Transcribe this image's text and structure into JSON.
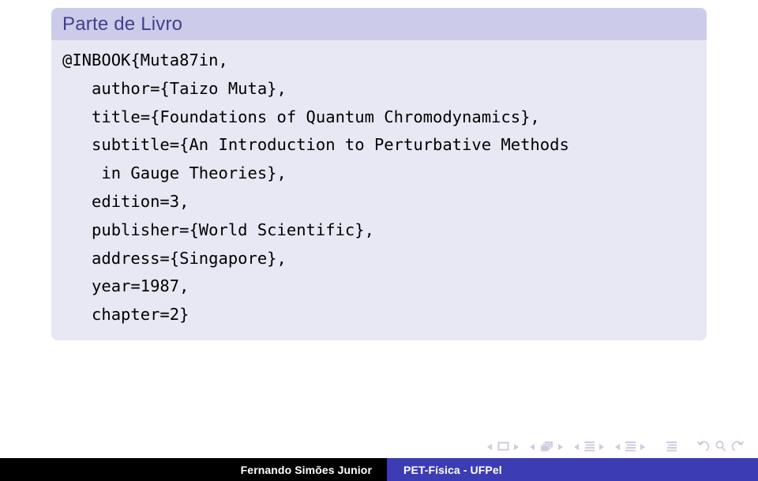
{
  "block": {
    "title": "Parte de Livro",
    "code_lines": [
      "@INBOOK{Muta87in,",
      "   author={Taizo Muta},",
      "   title={Foundations of Quantum Chromodynamics},",
      "   subtitle={An Introduction to Perturbative Methods",
      "    in Gauge Theories},",
      "   edition=3,",
      "   publisher={World Scientific},",
      "   address={Singapore},",
      "   year=1987,",
      "   chapter=2}"
    ],
    "code_text": "@INBOOK{Muta87in,\n   author={Taizo Muta},\n   title={Foundations of Quantum Chromodynamics},\n   subtitle={An Introduction to Perturbative Methods\n    in Gauge Theories},\n   edition=3,\n   publisher={World Scientific},\n   address={Singapore},\n   year=1987,\n   chapter=2}"
  },
  "navigation": {
    "items": [
      {
        "name": "slide-backward",
        "icon": "triangle-left"
      },
      {
        "name": "slide-indicator",
        "icon": "slide"
      },
      {
        "name": "slide-forward",
        "icon": "triangle-right"
      },
      {
        "name": "frame-backward",
        "icon": "triangle-left"
      },
      {
        "name": "frame-indicator",
        "icon": "frames"
      },
      {
        "name": "frame-forward",
        "icon": "triangle-right"
      },
      {
        "name": "subsection-backward",
        "icon": "triangle-left"
      },
      {
        "name": "subsection-indicator",
        "icon": "subsection"
      },
      {
        "name": "subsection-forward",
        "icon": "triangle-right"
      },
      {
        "name": "section-backward",
        "icon": "triangle-left"
      },
      {
        "name": "section-indicator",
        "icon": "section"
      },
      {
        "name": "section-forward",
        "icon": "triangle-right"
      },
      {
        "name": "presentation-indicator",
        "icon": "presentation"
      },
      {
        "name": "back-arrow",
        "icon": "arrow-back"
      },
      {
        "name": "search",
        "icon": "magnifier"
      },
      {
        "name": "forward-arrow",
        "icon": "arrow-forward"
      }
    ]
  },
  "footer": {
    "author": "Fernando Simões Junior",
    "institute": "PET-Física - UFPel"
  },
  "colors": {
    "block_title_bg": "#ccccea",
    "block_title_text": "#3f3f8f",
    "block_body_bg": "#e8e8f4",
    "footer_left_bg": "#000000",
    "footer_right_bg": "#3c3cb4",
    "nav_symbol": "#ccccdf"
  }
}
